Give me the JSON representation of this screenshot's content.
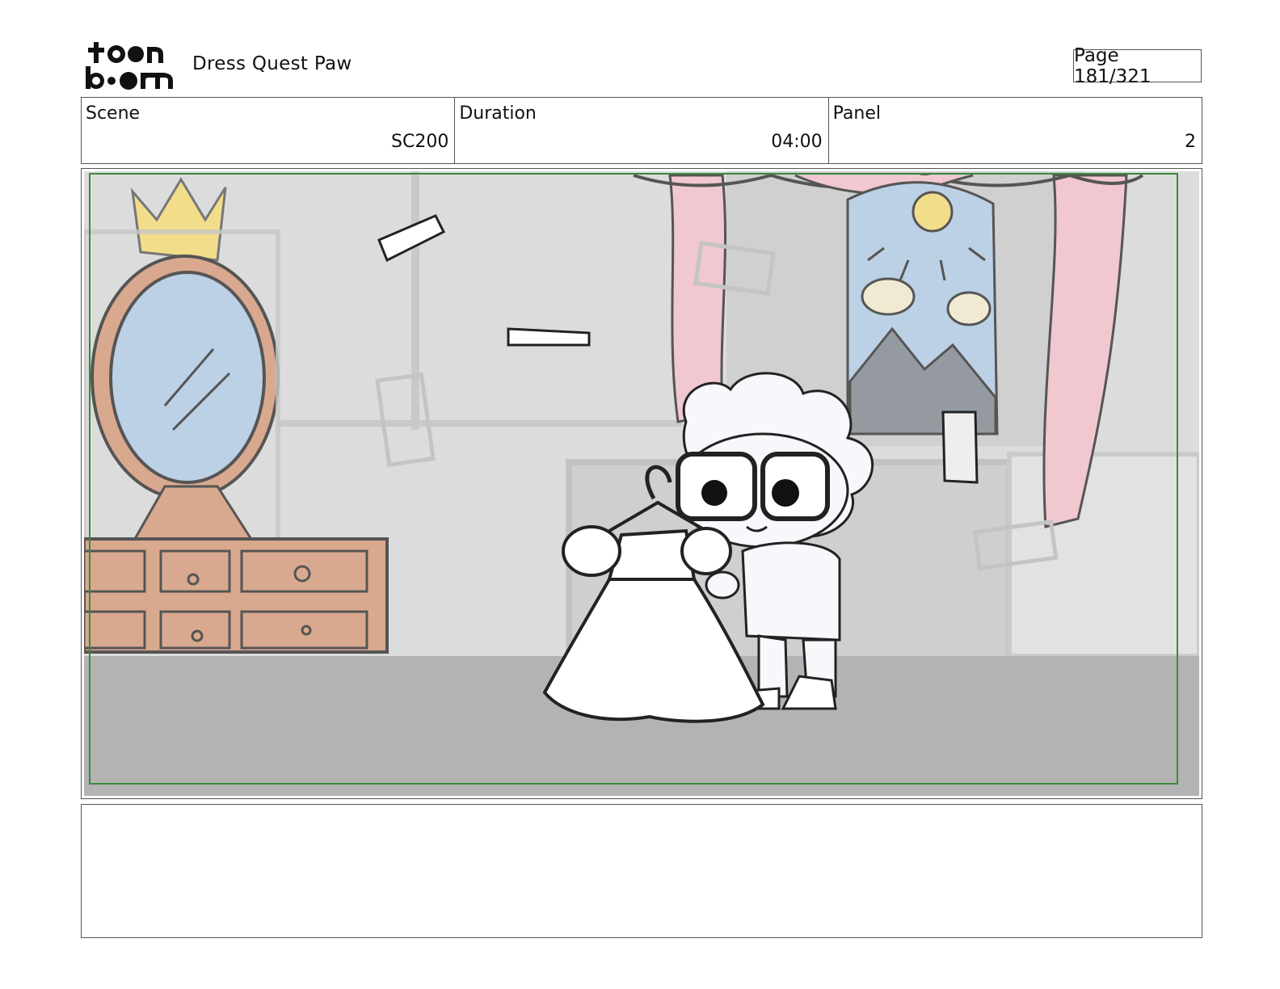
{
  "header": {
    "logo_text": "toon boom",
    "project_title": "Dress Quest Paw",
    "page_indicator": "Page 181/321"
  },
  "info": {
    "scene_label": "Scene",
    "scene_value": "SC200",
    "duration_label": "Duration",
    "duration_value": "04:00",
    "panel_label": "Panel",
    "panel_value": "2"
  },
  "notes": {
    "text": ""
  },
  "colors": {
    "safe_frame": "#3a8a3a",
    "floor": "#b3b3b3",
    "wall": "#dcdcdc",
    "curtain": "#f1c7d0",
    "mirror": "#bcd0e6",
    "dresser": "#d9a98f",
    "crown": "#f2dd8a"
  }
}
